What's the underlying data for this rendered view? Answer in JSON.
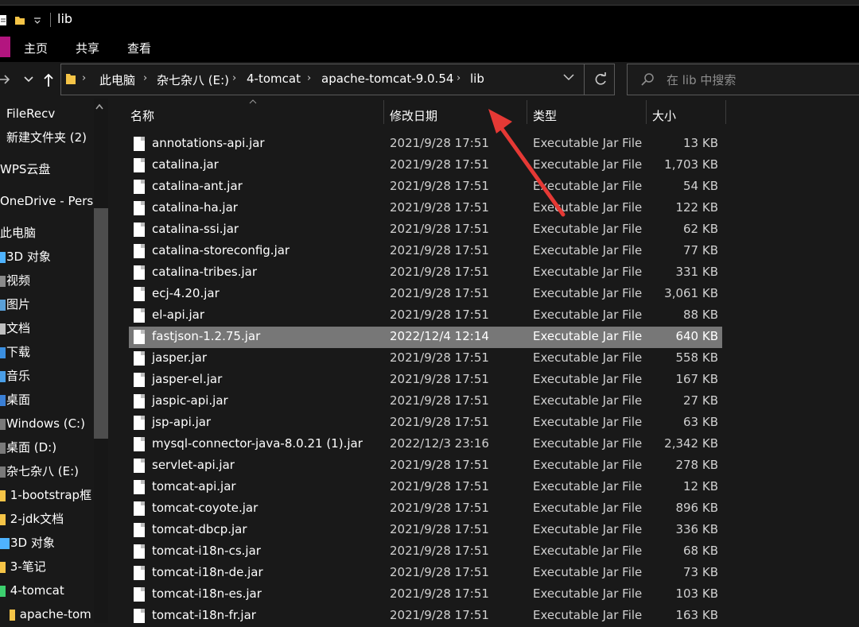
{
  "window": {
    "title": "lib"
  },
  "ribbon": {
    "tabs": [
      "主页",
      "共享",
      "查看"
    ]
  },
  "address": {
    "breadcrumbs": [
      "此电脑",
      "杂七杂八 (E:)",
      "4-tomcat",
      "apache-tomcat-9.0.54",
      "lib"
    ],
    "separator": "›"
  },
  "search": {
    "placeholder": "在 lib 中搜索"
  },
  "sidebar": {
    "items": [
      {
        "label": "FileRecv"
      },
      {
        "label": "新建文件夹 (2)"
      },
      {
        "label": "WPS云盘"
      },
      {
        "label": "OneDrive - Perso"
      },
      {
        "label": "此电脑"
      },
      {
        "label": "3D 对象"
      },
      {
        "label": "视频"
      },
      {
        "label": "图片"
      },
      {
        "label": "文档"
      },
      {
        "label": "下载"
      },
      {
        "label": "音乐"
      },
      {
        "label": "桌面"
      },
      {
        "label": "Windows (C:)"
      },
      {
        "label": "桌面 (D:)"
      },
      {
        "label": "杂七杂八 (E:)"
      },
      {
        "label": "1-bootstrap框"
      },
      {
        "label": "2-jdk文档"
      },
      {
        "label": "3D 对象"
      },
      {
        "label": "3-笔记"
      },
      {
        "label": "4-tomcat"
      },
      {
        "label": "apache-tom"
      }
    ]
  },
  "columns": {
    "name": "名称",
    "date": "修改日期",
    "type": "类型",
    "size": "大小"
  },
  "files": [
    {
      "name": "annotations-api.jar",
      "date": "2021/9/28 17:51",
      "type": "Executable Jar File",
      "size": "13 KB"
    },
    {
      "name": "catalina.jar",
      "date": "2021/9/28 17:51",
      "type": "Executable Jar File",
      "size": "1,703 KB"
    },
    {
      "name": "catalina-ant.jar",
      "date": "2021/9/28 17:51",
      "type": "Executable Jar File",
      "size": "54 KB"
    },
    {
      "name": "catalina-ha.jar",
      "date": "2021/9/28 17:51",
      "type": "Executable Jar File",
      "size": "122 KB"
    },
    {
      "name": "catalina-ssi.jar",
      "date": "2021/9/28 17:51",
      "type": "Executable Jar File",
      "size": "62 KB"
    },
    {
      "name": "catalina-storeconfig.jar",
      "date": "2021/9/28 17:51",
      "type": "Executable Jar File",
      "size": "77 KB"
    },
    {
      "name": "catalina-tribes.jar",
      "date": "2021/9/28 17:51",
      "type": "Executable Jar File",
      "size": "331 KB"
    },
    {
      "name": "ecj-4.20.jar",
      "date": "2021/9/28 17:51",
      "type": "Executable Jar File",
      "size": "3,061 KB"
    },
    {
      "name": "el-api.jar",
      "date": "2021/9/28 17:51",
      "type": "Executable Jar File",
      "size": "88 KB"
    },
    {
      "name": "fastjson-1.2.75.jar",
      "date": "2022/12/4 12:14",
      "type": "Executable Jar File",
      "size": "640 KB",
      "selected": true
    },
    {
      "name": "jasper.jar",
      "date": "2021/9/28 17:51",
      "type": "Executable Jar File",
      "size": "558 KB"
    },
    {
      "name": "jasper-el.jar",
      "date": "2021/9/28 17:51",
      "type": "Executable Jar File",
      "size": "167 KB"
    },
    {
      "name": "jaspic-api.jar",
      "date": "2021/9/28 17:51",
      "type": "Executable Jar File",
      "size": "27 KB"
    },
    {
      "name": "jsp-api.jar",
      "date": "2021/9/28 17:51",
      "type": "Executable Jar File",
      "size": "63 KB"
    },
    {
      "name": "mysql-connector-java-8.0.21 (1).jar",
      "date": "2022/12/3 23:16",
      "type": "Executable Jar File",
      "size": "2,342 KB"
    },
    {
      "name": "servlet-api.jar",
      "date": "2021/9/28 17:51",
      "type": "Executable Jar File",
      "size": "278 KB"
    },
    {
      "name": "tomcat-api.jar",
      "date": "2021/9/28 17:51",
      "type": "Executable Jar File",
      "size": "12 KB"
    },
    {
      "name": "tomcat-coyote.jar",
      "date": "2021/9/28 17:51",
      "type": "Executable Jar File",
      "size": "896 KB"
    },
    {
      "name": "tomcat-dbcp.jar",
      "date": "2021/9/28 17:51",
      "type": "Executable Jar File",
      "size": "336 KB"
    },
    {
      "name": "tomcat-i18n-cs.jar",
      "date": "2021/9/28 17:51",
      "type": "Executable Jar File",
      "size": "68 KB"
    },
    {
      "name": "tomcat-i18n-de.jar",
      "date": "2021/9/28 17:51",
      "type": "Executable Jar File",
      "size": "73 KB"
    },
    {
      "name": "tomcat-i18n-es.jar",
      "date": "2021/9/28 17:51",
      "type": "Executable Jar File",
      "size": "103 KB"
    },
    {
      "name": "tomcat-i18n-fr.jar",
      "date": "2021/9/28 17:51",
      "type": "Executable Jar File",
      "size": "163 KB"
    }
  ],
  "colors": {
    "accent_file_tab": "#b3157f",
    "selection": "#777777",
    "annotation_arrow": "#e53935"
  }
}
